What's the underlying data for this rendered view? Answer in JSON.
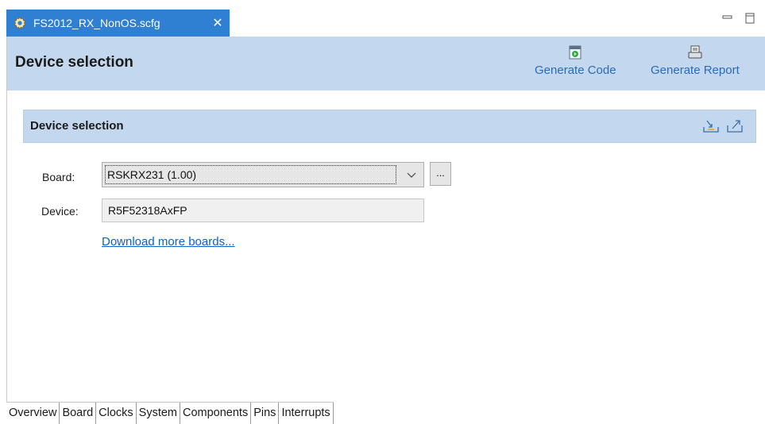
{
  "tab": {
    "title": "FS2012_RX_NonOS.scfg",
    "close_glyph": "✕",
    "icon": "gear-icon"
  },
  "window_controls": {
    "minimize": "minimize-icon",
    "maximize": "maximize-icon"
  },
  "header": {
    "title": "Device selection",
    "actions": [
      {
        "label": "Generate Code",
        "icon": "generate-code-icon"
      },
      {
        "label": "Generate Report",
        "icon": "generate-report-icon"
      }
    ]
  },
  "section": {
    "title": "Device selection",
    "icons": [
      "import-icon",
      "export-icon"
    ]
  },
  "form": {
    "board_label": "Board:",
    "board_value": "RSKRX231 (1.00)",
    "browse_label": "...",
    "device_label": "Device:",
    "device_value": "R5F52318AxFP",
    "download_link": "Download more boards..."
  },
  "page_tabs": [
    "Overview",
    "Board",
    "Clocks",
    "System",
    "Components",
    "Pins",
    "Interrupts"
  ],
  "active_page_tab": "Board",
  "colors": {
    "tab_active": "#2f7fd2",
    "header_bg": "#c3d8ef",
    "link": "#0b63c7"
  }
}
